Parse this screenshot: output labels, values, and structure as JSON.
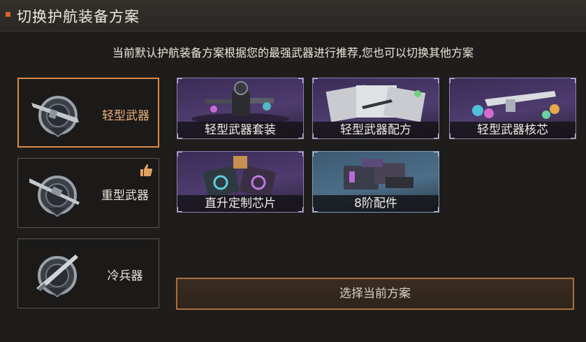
{
  "header": {
    "title": "切换护航装备方案"
  },
  "description": "当前默认护航装备方案根据您的最强武器进行推荐,您也可以切换其他方案",
  "categories": [
    {
      "label": "轻型武器",
      "icon": "light-weapon-emblem-icon",
      "selected": true
    },
    {
      "label": "重型武器",
      "icon": "heavy-weapon-emblem-icon",
      "recommended": true
    },
    {
      "label": "冷兵器",
      "icon": "melee-weapon-emblem-icon"
    }
  ],
  "items": [
    {
      "label": "轻型武器套装",
      "rarity": "purple"
    },
    {
      "label": "轻型武器配方",
      "rarity": "purple"
    },
    {
      "label": "轻型武器核芯",
      "rarity": "purple"
    },
    {
      "label": "直升定制芯片",
      "rarity": "purple"
    },
    {
      "label": "8阶配件",
      "rarity": "blue"
    }
  ],
  "select_button": "选择当前方案",
  "colors": {
    "accent": "#d8894a",
    "header_marker": "#d9622b",
    "purple_frame": "#4e3c6e",
    "blue_frame": "#4d6e88"
  }
}
